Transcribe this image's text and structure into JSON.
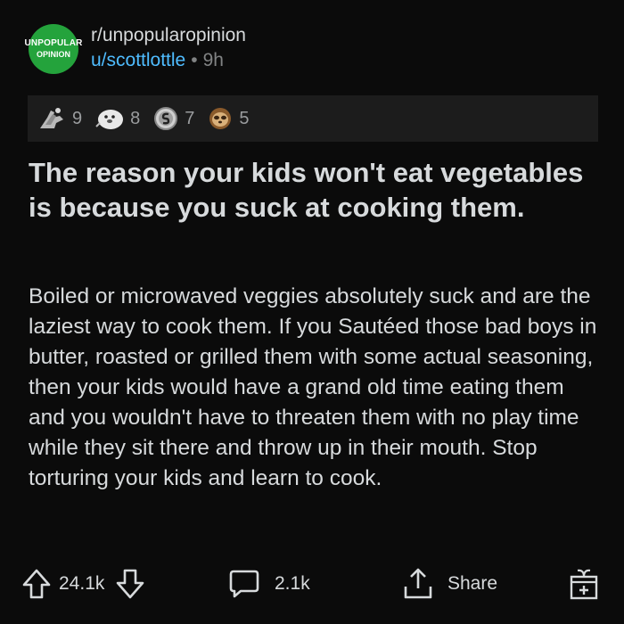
{
  "post": {
    "subreddit": "r/unpopularopinion",
    "avatar_line1": "UNPOPULAR",
    "avatar_line2": "OPINION",
    "author": "u/scottlottle",
    "separator": "•",
    "age": "9h",
    "awards": [
      {
        "icon": "helpful-hands-award-icon",
        "count": "9"
      },
      {
        "icon": "wholesome-seal-award-icon",
        "count": "8"
      },
      {
        "icon": "silver-award-icon",
        "count": "7"
      },
      {
        "icon": "sloth-award-icon",
        "count": "5"
      }
    ],
    "title": "The reason your kids won't eat vegetables is because you suck at cooking them.",
    "body": "Boiled or microwaved veggies absolutely suck and are the laziest way to cook them. If you Sautéed those bad boys in butter, roasted or grilled them with some actual seasoning, then your kids would have a grand old time eating them and you wouldn't have to threaten them with no play time while they sit there and throw up in their mouth. Stop torturing your kids and learn to cook."
  },
  "actions": {
    "upvote_icon": "arrow-up-icon",
    "score": "24.1k",
    "downvote_icon": "arrow-down-icon",
    "comment_icon": "comment-bubble-icon",
    "comments": "2.1k",
    "share_icon": "share-icon",
    "share_label": "Share",
    "award_icon": "gift-icon"
  },
  "colors": {
    "background": "#0b0b0b",
    "avatar_green": "#24a33c",
    "username_blue": "#4fbcff",
    "muted": "#818384",
    "text": "#d7dadc"
  }
}
